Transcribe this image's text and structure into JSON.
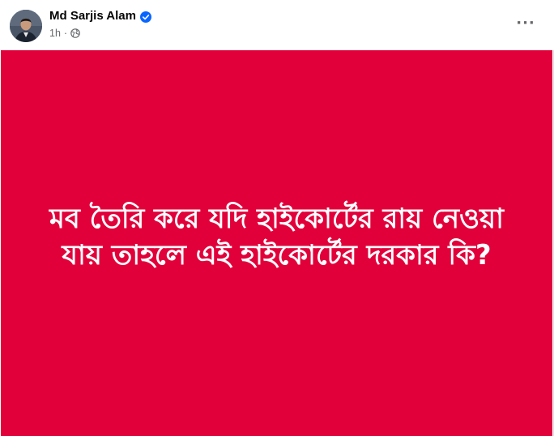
{
  "post": {
    "author_name": "Md Sarjis Alam",
    "verified_icon": "verified-badge-icon",
    "time": "1h",
    "separator": "·",
    "audience_icon": "globe-icon",
    "more_icon": "more-options-icon",
    "more_glyph": "···",
    "image": {
      "background_color": "#e1003a",
      "text_color": "#ffffff",
      "text": "মব তৈরি করে যদি হাইকোর্টের রায় নেওয়া যায় তাহলে এই হাইকোর্টের দরকার কি?"
    }
  },
  "colors": {
    "verified_blue": "#0866ff",
    "secondary_text": "#65676b",
    "primary_text": "#050505"
  }
}
